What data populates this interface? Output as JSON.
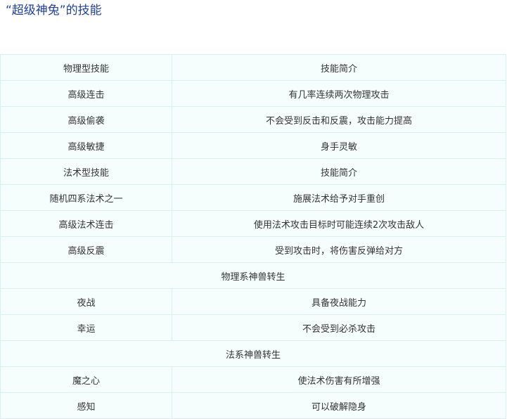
{
  "heading": "“超级神兔”的技能",
  "rows": [
    {
      "type": "pair",
      "name": "物理型技能",
      "desc": "技能简介"
    },
    {
      "type": "pair",
      "name": "高级连击",
      "desc": "有几率连续两次物理攻击"
    },
    {
      "type": "pair",
      "name": "高级偷袭",
      "desc": "不会受到反击和反震，攻击能力提高"
    },
    {
      "type": "pair",
      "name": "高级敏捷",
      "desc": "身手灵敏"
    },
    {
      "type": "pair",
      "name": "法术型技能",
      "desc": "技能简介"
    },
    {
      "type": "pair",
      "name": "随机四系法术之一",
      "desc": "施展法术给予对手重创"
    },
    {
      "type": "pair",
      "name": "高级法术连击",
      "desc": "使用法术攻击目标时可能连续2次攻击敌人"
    },
    {
      "type": "pair",
      "name": "高级反震",
      "desc": "受到攻击时，将伤害反弹给对方"
    },
    {
      "type": "section",
      "label": "物理系神兽转生"
    },
    {
      "type": "pair",
      "name": "夜战",
      "desc": "具备夜战能力"
    },
    {
      "type": "pair",
      "name": "幸运",
      "desc": "不会受到必杀攻击"
    },
    {
      "type": "section",
      "label": "法系神兽转生"
    },
    {
      "type": "pair",
      "name": "魔之心",
      "desc": "使法术伤害有所增强"
    },
    {
      "type": "pair",
      "name": "感知",
      "desc": "可以破解隐身"
    }
  ]
}
